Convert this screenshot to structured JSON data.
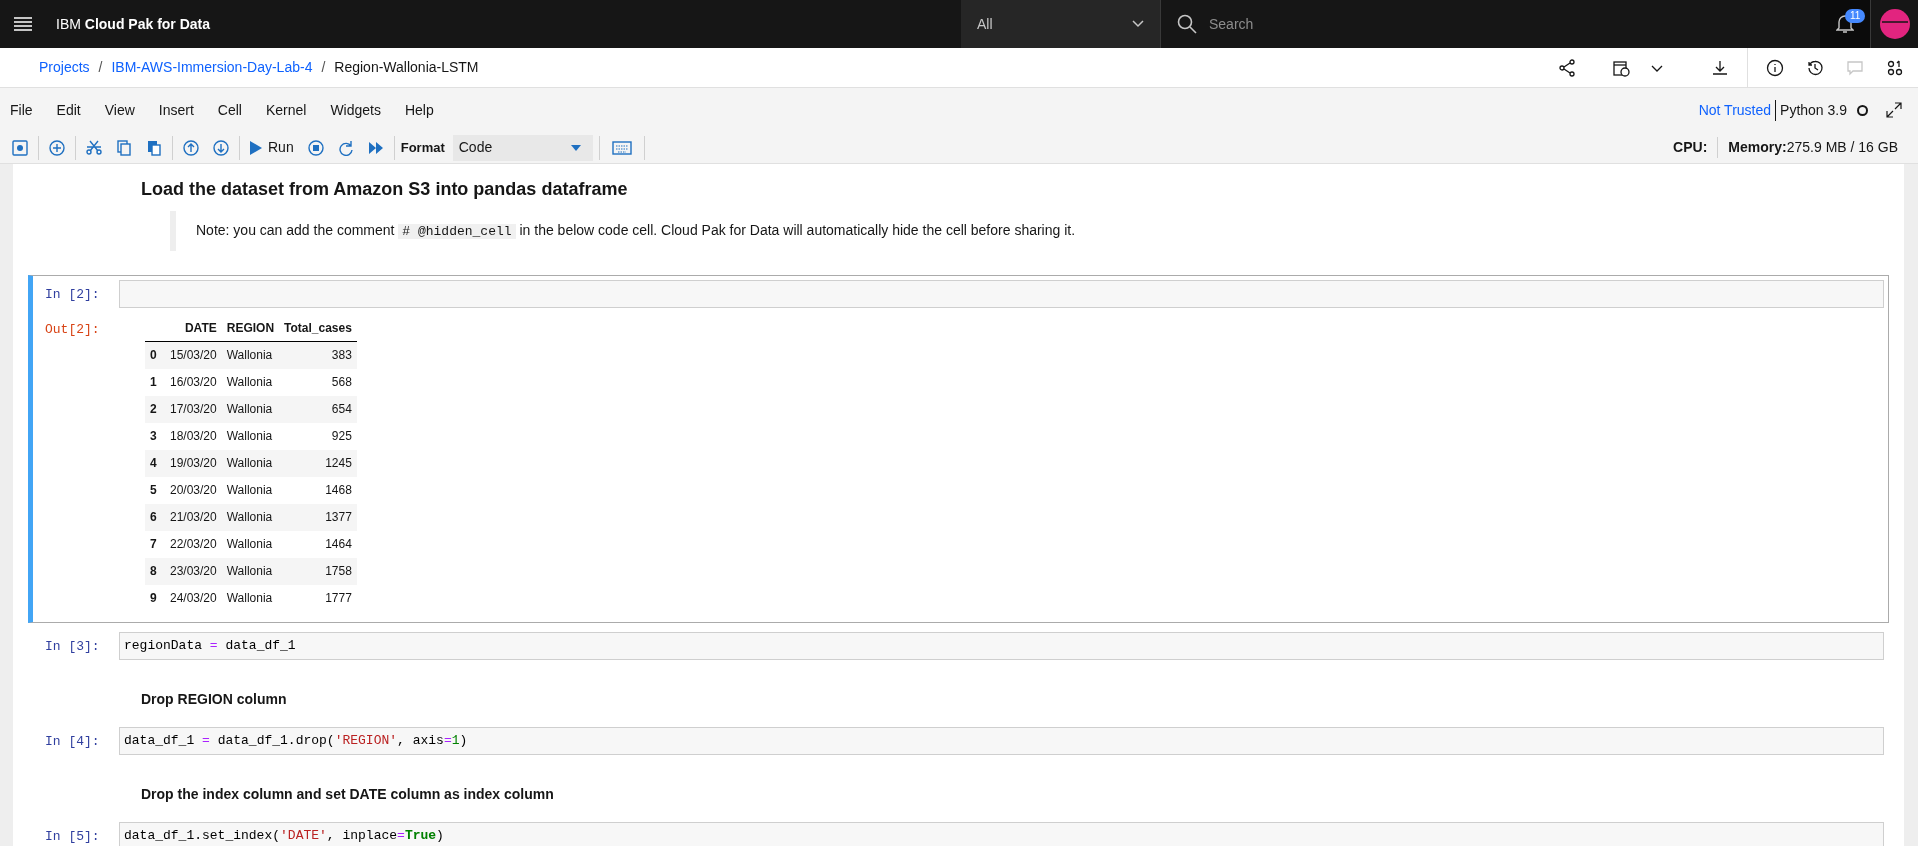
{
  "top_bar": {
    "title": "IBM **Cloud Pak for Data**",
    "scope": "All",
    "search": {
      "placeholder": "Search"
    },
    "notification_count": "11"
  },
  "breadcrumbs": {
    "separator": "/",
    "items": [
      {
        "label": "Projects",
        "link": true
      },
      {
        "label": "IBM-AWS-Immersion-Day-Lab-4",
        "link": true
      },
      {
        "label": "Region-Wallonia-LSTM",
        "link": false
      }
    ]
  },
  "menu": [
    "File",
    "Edit",
    "View",
    "Insert",
    "Cell",
    "Kernel",
    "Widgets",
    "Help"
  ],
  "kernel": {
    "trust": "Not Trusted",
    "name": "Python 3.9",
    "busy": false
  },
  "toolbar": {
    "groups": [
      [
        {
          "kind": "save"
        }
      ],
      [
        {
          "kind": "add"
        }
      ],
      [
        {
          "kind": "cut"
        },
        {
          "kind": "copy"
        },
        {
          "kind": "paste"
        }
      ],
      [
        {
          "kind": "up"
        },
        {
          "kind": "down"
        }
      ],
      [
        {
          "kind": "run",
          "label": "Run"
        },
        {
          "kind": "stop"
        },
        {
          "kind": "restart"
        },
        {
          "kind": "fastforward"
        }
      ]
    ],
    "format_label": "Format",
    "format_value": "Code"
  },
  "resources": {
    "cpu_label": "CPU:",
    "memory_label": "Memory:",
    "memory_value": "275.9 MB / 16 GB"
  },
  "cells": [
    {
      "kind": "heading",
      "text": "Load the dataset from Amazon S3 into pandas dataframe"
    },
    {
      "kind": "note",
      "parts": [
        {
          "text": "Note: you can add the comment ",
          "code": false
        },
        {
          "text": "# @hidden_cell",
          "code": true
        },
        {
          "text": " in the below code cell. Cloud Pak for Data will automatically hide the cell before sharing it.",
          "code": false
        }
      ]
    },
    {
      "kind": "code",
      "prompt": "In [2]:",
      "selected": true,
      "output": {
        "prompt": "Out[2]:",
        "columns": [
          "DATE",
          "REGION",
          "Total_cases"
        ],
        "rows": [
          {
            "index": "0",
            "cells": [
              "15/03/20",
              "Wallonia",
              "383"
            ]
          },
          {
            "index": "1",
            "cells": [
              "16/03/20",
              "Wallonia",
              "568"
            ]
          },
          {
            "index": "2",
            "cells": [
              "17/03/20",
              "Wallonia",
              "654"
            ]
          },
          {
            "index": "3",
            "cells": [
              "18/03/20",
              "Wallonia",
              "925"
            ]
          },
          {
            "index": "4",
            "cells": [
              "19/03/20",
              "Wallonia",
              "1245"
            ]
          },
          {
            "index": "5",
            "cells": [
              "20/03/20",
              "Wallonia",
              "1468"
            ]
          },
          {
            "index": "6",
            "cells": [
              "21/03/20",
              "Wallonia",
              "1377"
            ]
          },
          {
            "index": "7",
            "cells": [
              "22/03/20",
              "Wallonia",
              "1464"
            ]
          },
          {
            "index": "8",
            "cells": [
              "23/03/20",
              "Wallonia",
              "1758"
            ]
          },
          {
            "index": "9",
            "cells": [
              "24/03/20",
              "Wallonia",
              "1777"
            ]
          }
        ]
      }
    },
    {
      "kind": "code",
      "prompt": "In [3]:",
      "selected": false,
      "tokens": [
        {
          "text": "regionData ",
          "kind": "plain"
        },
        {
          "text": "=",
          "kind": "operator"
        },
        {
          "text": " data_df_1",
          "kind": "plain"
        }
      ]
    },
    {
      "kind": "subheading",
      "text": "Drop REGION column"
    },
    {
      "kind": "code",
      "prompt": "In [4]:",
      "selected": false,
      "tokens": [
        {
          "text": "data_df_1 ",
          "kind": "plain"
        },
        {
          "text": "=",
          "kind": "operator"
        },
        {
          "text": " data_df_1.drop(",
          "kind": "plain"
        },
        {
          "text": "'REGION'",
          "kind": "string"
        },
        {
          "text": ", axis",
          "kind": "plain"
        },
        {
          "text": "=",
          "kind": "operator"
        },
        {
          "text": "1",
          "kind": "number"
        },
        {
          "text": ")",
          "kind": "plain"
        }
      ]
    },
    {
      "kind": "subheading",
      "text": "Drop the index column and set DATE column as index column"
    },
    {
      "kind": "code",
      "prompt": "In [5]:",
      "selected": false,
      "tokens": [
        {
          "text": "data_df_1.set_index(",
          "kind": "plain"
        },
        {
          "text": "'DATE'",
          "kind": "string"
        },
        {
          "text": ", inplace",
          "kind": "plain"
        },
        {
          "text": "=",
          "kind": "operator"
        },
        {
          "text": "True",
          "kind": "keyword"
        },
        {
          "text": ")",
          "kind": "plain"
        }
      ]
    }
  ]
}
